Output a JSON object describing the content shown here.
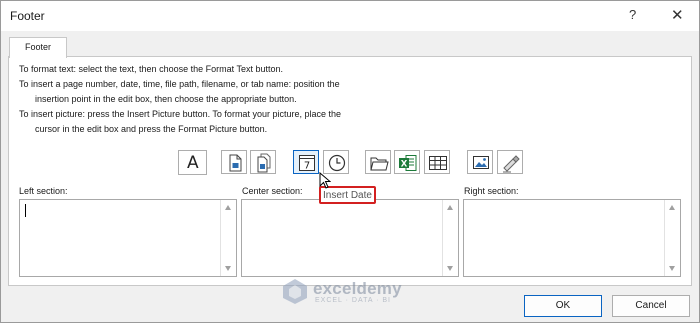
{
  "window": {
    "title": "Footer",
    "help_glyph": "?",
    "close_glyph": "✕"
  },
  "tabs": [
    {
      "label": "Footer",
      "selected": true
    }
  ],
  "instructions": [
    "To format text:  select the text, then choose the Format Text button.",
    "To insert a page number, date, time, file path, filename, or tab name:  position the",
    "insertion point in the edit box, then choose the appropriate button.",
    "To insert picture: press the Insert Picture button.  To format your picture, place the",
    "cursor in the edit box and press the Format Picture button."
  ],
  "toolbar": {
    "buttons": [
      {
        "name": "format-text",
        "icon": "format-text-icon",
        "glyph": "A"
      },
      {
        "name": "insert-page-number",
        "icon": "page-number-icon"
      },
      {
        "name": "insert-number-of-pages",
        "icon": "number-of-pages-icon"
      },
      {
        "name": "insert-date",
        "icon": "calendar-icon",
        "glyph": "7",
        "state": "hovered"
      },
      {
        "name": "insert-time",
        "icon": "clock-icon"
      },
      {
        "name": "insert-file-path",
        "icon": "folder-icon"
      },
      {
        "name": "insert-file-name",
        "icon": "excel-file-icon",
        "glyph": "X"
      },
      {
        "name": "insert-sheet-name",
        "icon": "sheet-icon"
      },
      {
        "name": "insert-picture",
        "icon": "picture-icon"
      },
      {
        "name": "format-picture",
        "icon": "format-picture-icon"
      }
    ]
  },
  "tooltip": {
    "text": "Insert Date"
  },
  "sections": {
    "left": {
      "label": "Left section:",
      "value": ""
    },
    "center": {
      "label": "Center section:",
      "value": ""
    },
    "right": {
      "label": "Right section:",
      "value": ""
    }
  },
  "watermark": {
    "name": "exceldemy",
    "tagline": "EXCEL · DATA · BI"
  },
  "buttons": {
    "ok": "OK",
    "cancel": "Cancel"
  },
  "colors": {
    "accent": "#0a64c2",
    "highlight_border": "#d32020",
    "excel_green": "#1d7a3a"
  }
}
